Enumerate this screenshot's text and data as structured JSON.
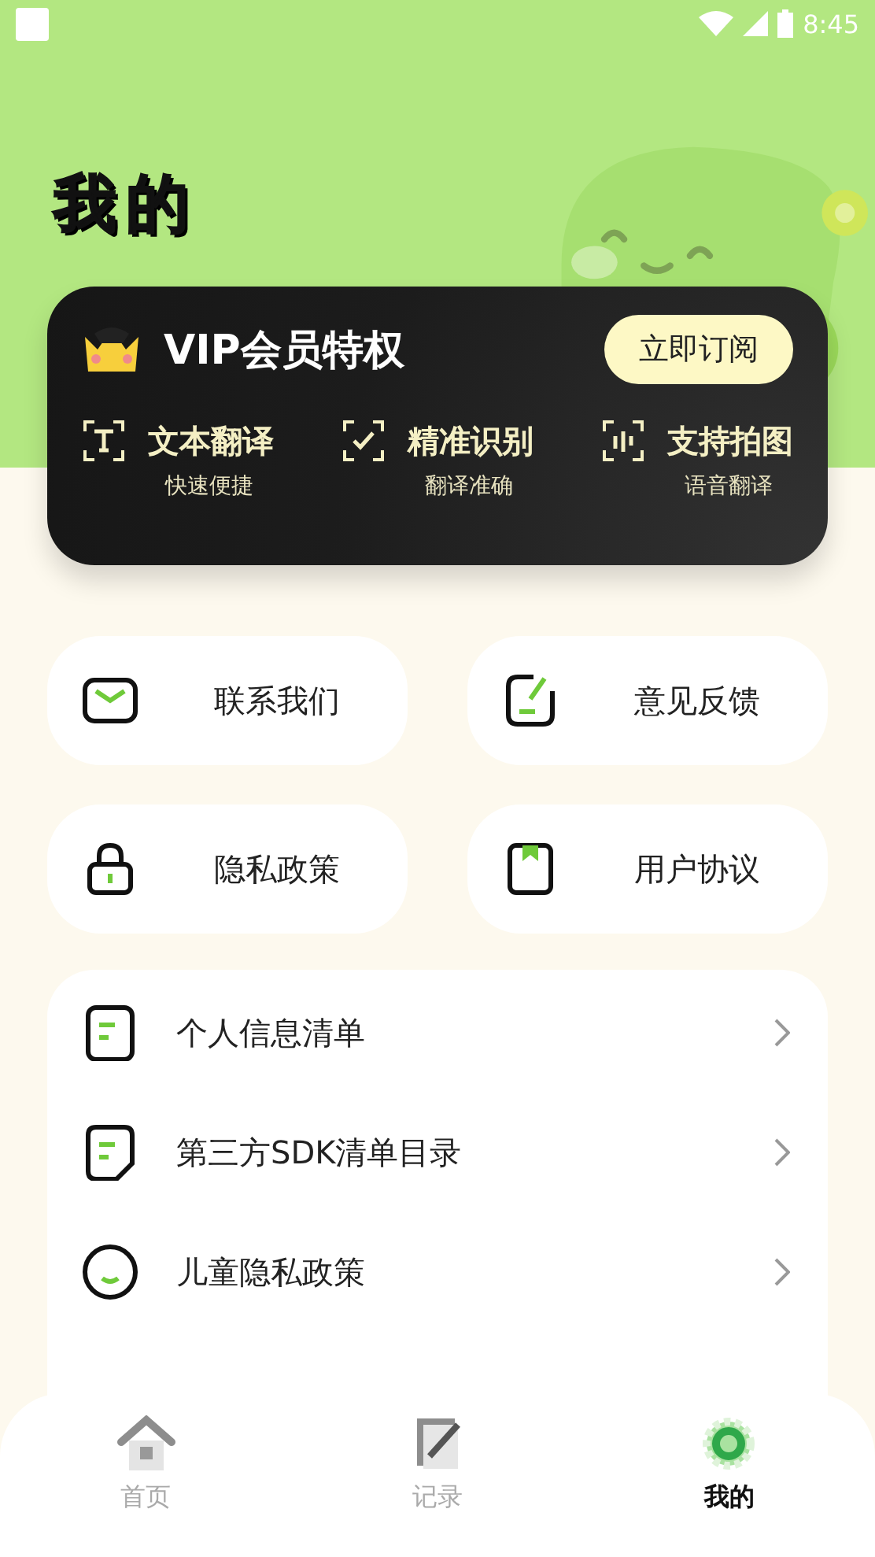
{
  "status_bar": {
    "time": "8:45"
  },
  "title": "我的",
  "vip": {
    "title": "VIP会员特权",
    "button": "立即订阅",
    "features": [
      {
        "kind": "text",
        "name": "文本翻译",
        "desc": "快速便捷"
      },
      {
        "kind": "check",
        "name": "精准识别",
        "desc": "翻译准确"
      },
      {
        "kind": "voice",
        "name": "支持拍图",
        "desc": "语音翻译"
      }
    ]
  },
  "quick_links": [
    {
      "kind": "mail",
      "label": "联系我们"
    },
    {
      "kind": "feedback",
      "label": "意见反馈"
    },
    {
      "kind": "lock",
      "label": "隐私政策"
    },
    {
      "kind": "book",
      "label": "用户协议"
    }
  ],
  "menu": [
    {
      "kind": "doc",
      "label": "个人信息清单"
    },
    {
      "kind": "doc2",
      "label": "第三方SDK清单目录"
    },
    {
      "kind": "smile",
      "label": "儿童隐私政策"
    }
  ],
  "tab_bar": [
    {
      "kind": "home",
      "label": "首页",
      "selected": false
    },
    {
      "kind": "record",
      "label": "记录",
      "selected": false
    },
    {
      "kind": "gear",
      "label": "我的",
      "selected": true
    }
  ]
}
